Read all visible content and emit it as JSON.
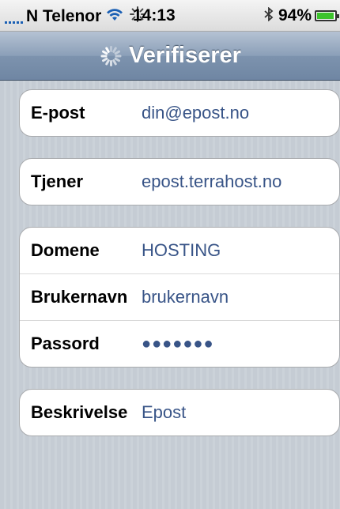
{
  "status_bar": {
    "carrier": "N Telenor",
    "time": "14:13",
    "battery_percent": "94%",
    "battery_level": 0.94,
    "icons": [
      "signal-icon",
      "wifi-icon",
      "activity-icon",
      "bluetooth-icon",
      "battery-icon"
    ],
    "accent_color": "#1a5fb4"
  },
  "nav": {
    "title": "Verifiserer"
  },
  "form": {
    "group1": [
      {
        "label": "E-post",
        "value": "din@epost.no"
      }
    ],
    "group2": [
      {
        "label": "Tjener",
        "value": "epost.terrahost.no"
      }
    ],
    "group3": [
      {
        "label": "Domene",
        "value": "HOSTING"
      },
      {
        "label": "Brukernavn",
        "value": "brukernavn"
      },
      {
        "label": "Passord",
        "value": "●●●●●●●"
      }
    ],
    "group4": [
      {
        "label": "Beskrivelse",
        "value": "Epost"
      }
    ],
    "value_color": "#385487"
  }
}
